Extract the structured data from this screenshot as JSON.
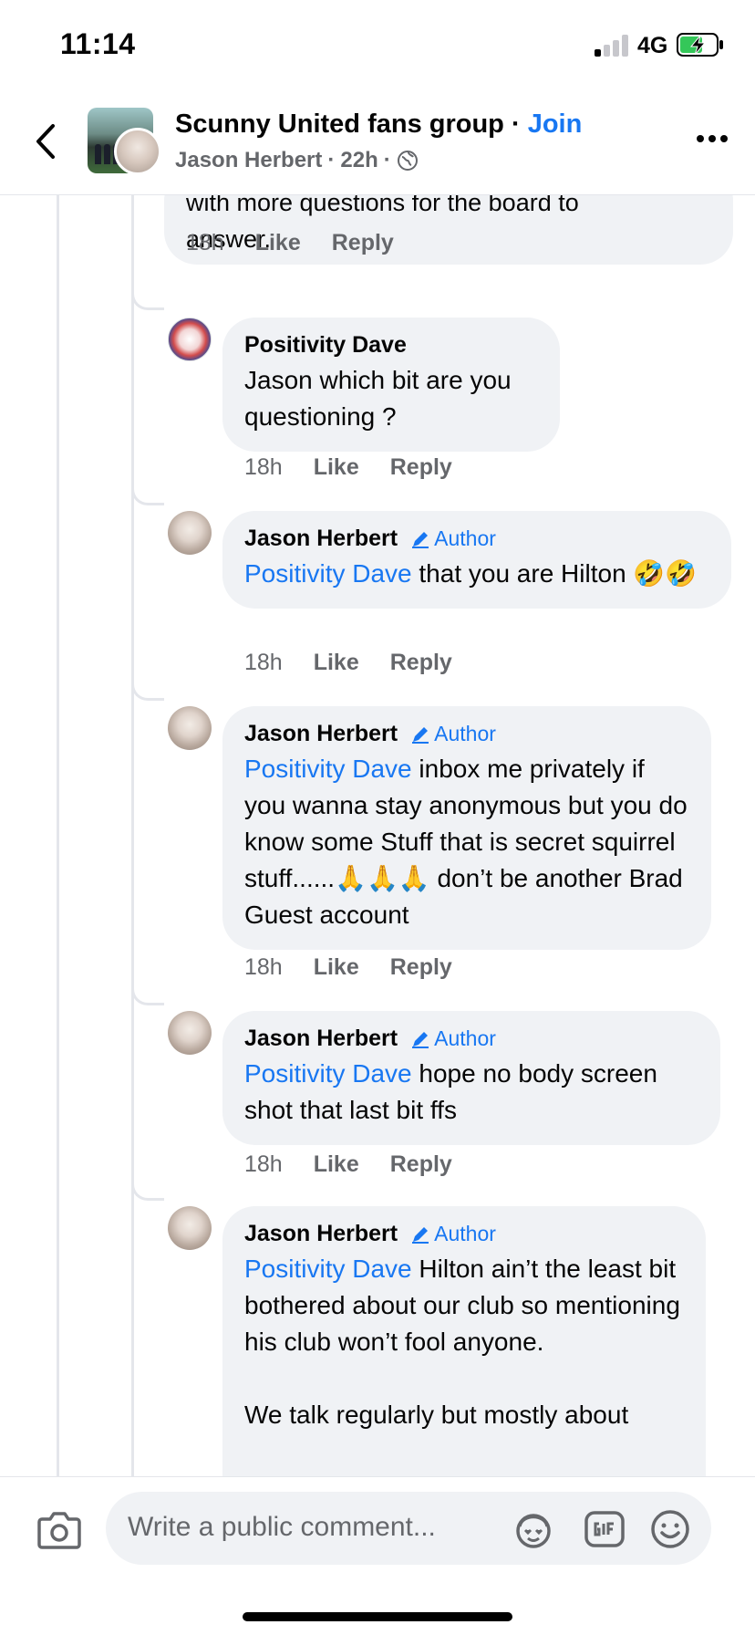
{
  "status_bar": {
    "time": "11:14",
    "network": "4G"
  },
  "header": {
    "group_name": "Scunny United fans group",
    "separator": " · ",
    "join_label": "Join",
    "poster": "Jason Herbert",
    "post_age": "22h"
  },
  "top_comment": {
    "cut_text": "with more questions for the board to",
    "text": "answer.",
    "time": "18h",
    "like": "Like",
    "reply": "Reply"
  },
  "replies": [
    {
      "author": "Positivity Dave",
      "badge": "",
      "mention": "",
      "text": "Jason which bit are you questioning ?",
      "time": "18h",
      "like": "Like",
      "reply": "Reply"
    },
    {
      "author": "Jason Herbert",
      "badge": "Author",
      "mention": "Positivity Dave",
      "text": " that you are Hilton 🤣🤣",
      "time": "18h",
      "like": "Like",
      "reply": "Reply"
    },
    {
      "author": "Jason Herbert",
      "badge": "Author",
      "mention": "Positivity Dave",
      "text": " inbox me privately if you wanna stay anonymous but you do know some Stuff that is secret squirrel stuff......🙏🙏🙏 don’t be another Brad Guest account",
      "time": "18h",
      "like": "Like",
      "reply": "Reply"
    },
    {
      "author": "Jason Herbert",
      "badge": "Author",
      "mention": "Positivity Dave",
      "text": " hope no body screen shot that last bit ffs",
      "time": "18h",
      "like": "Like",
      "reply": "Reply"
    },
    {
      "author": "Jason Herbert",
      "badge": "Author",
      "mention": "Positivity Dave",
      "text": " Hilton ain’t the least bit bothered about our club so mentioning his club won’t fool anyone.",
      "text2": "We talk regularly but mostly about",
      "time": "",
      "like": "",
      "reply": ""
    }
  ],
  "composer": {
    "placeholder": "Write a public comment..."
  },
  "colors": {
    "accent": "#1877f2",
    "bubble": "#f0f2f5",
    "secondary_text": "#65676b"
  }
}
